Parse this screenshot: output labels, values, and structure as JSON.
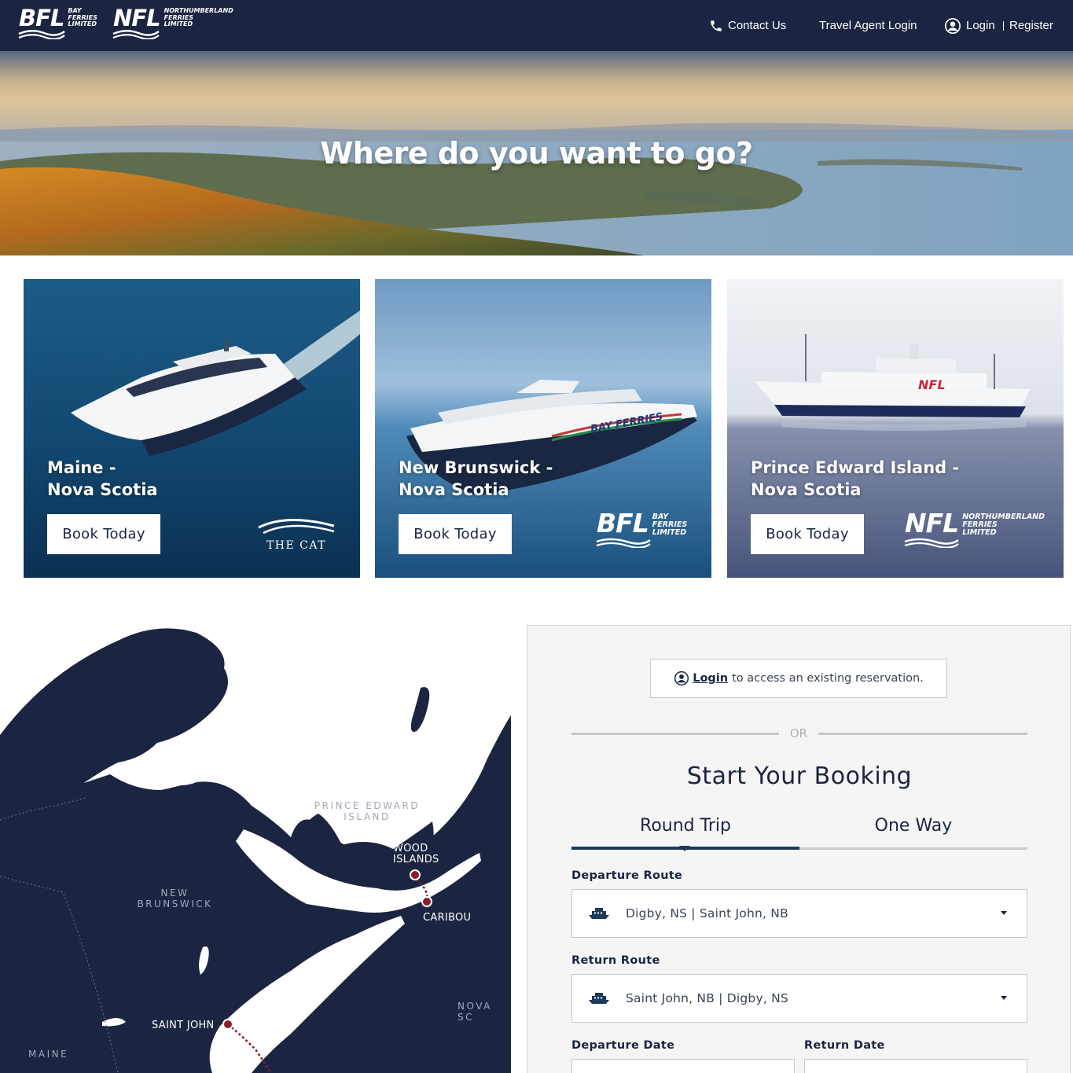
{
  "header": {
    "logos": [
      {
        "mark": "BFL",
        "sub": [
          "BAY",
          "FERRIES",
          "LIMITED"
        ]
      },
      {
        "mark": "NFL",
        "sub": [
          "NORTHUMBERLAND",
          "FERRIES",
          "LIMITED"
        ]
      }
    ],
    "nav": {
      "contact": "Contact Us",
      "travel_agent": "Travel Agent Login",
      "login": "Login",
      "register": "Register"
    }
  },
  "hero": {
    "title": "Where do you want to go?"
  },
  "cards": [
    {
      "title_line1": "Maine -",
      "title_line2": "Nova Scotia",
      "button": "Book Today",
      "brand": "THE CAT"
    },
    {
      "title_line1": "New Brunswick -",
      "title_line2": "Nova Scotia",
      "button": "Book Today",
      "brand_mark": "BFL",
      "brand_sub": [
        "BAY",
        "FERRIES",
        "LIMITED"
      ]
    },
    {
      "title_line1": "Prince Edward Island -",
      "title_line2": "Nova Scotia",
      "button": "Book Today",
      "brand_mark": "NFL",
      "brand_sub": [
        "NORTHUMBERLAND",
        "FERRIES",
        "LIMITED"
      ]
    }
  ],
  "map": {
    "regions": {
      "pei_line1": "PRINCE EDWARD",
      "pei_line2": "ISLAND",
      "nb_line1": "NEW",
      "nb_line2": "BRUNSWICK",
      "ns": "NOVA SC",
      "maine": "MAINE"
    },
    "ports": {
      "wood_line1": "WOOD",
      "wood_line2": "ISLANDS",
      "caribou": "CARIBOU",
      "saint_john": "SAINT JOHN"
    },
    "colors": {
      "land": "#1b2541",
      "route": "#8b1c2a"
    }
  },
  "booking": {
    "login_link": "Login",
    "login_text": "to access an existing reservation.",
    "or": "OR",
    "title": "Start Your Booking",
    "tabs": {
      "round_trip": "Round Trip",
      "one_way": "One Way",
      "active": "Round Trip"
    },
    "departure_label": "Departure Route",
    "departure_value": "Digby, NS | Saint John, NB",
    "return_label": "Return Route",
    "return_value": "Saint John, NB | Digby, NS",
    "departure_date_label": "Departure Date",
    "return_date_label": "Return Date"
  },
  "colors": {
    "navy": "#1b2541",
    "accent": "#1b3a5c",
    "panel_bg": "#f5f5f5"
  }
}
